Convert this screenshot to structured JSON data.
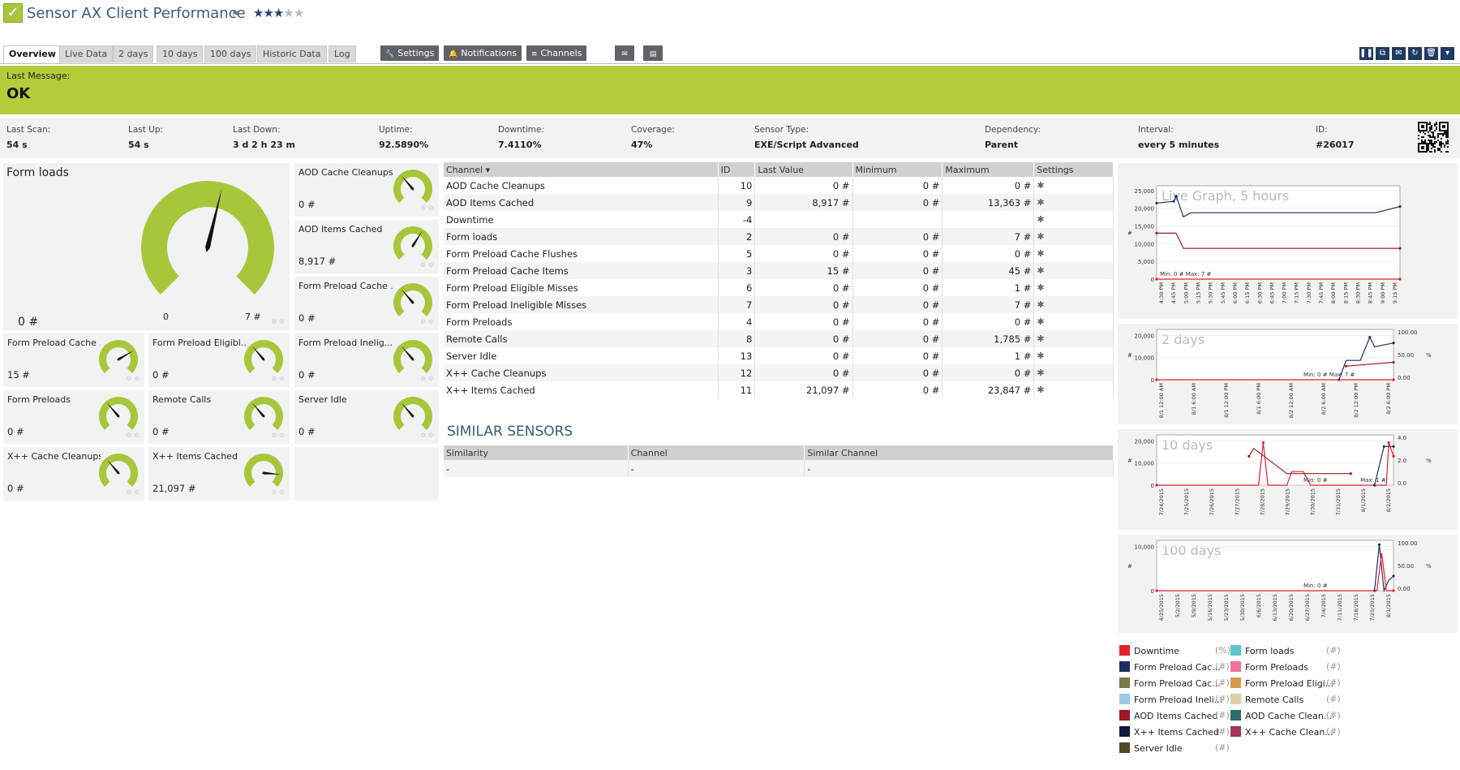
{
  "header": {
    "title": "Sensor AX Client Performance",
    "rating": 3,
    "rating_max": 5
  },
  "tabs": [
    "Overview",
    "Live Data",
    "2 days",
    "10 days",
    "100 days",
    "Historic Data",
    "Log"
  ],
  "actions": [
    "Settings",
    "Notifications",
    "Channels"
  ],
  "message": {
    "label": "Last Message:",
    "value": "OK"
  },
  "info": [
    {
      "label": "Last Scan:",
      "value": "54 s"
    },
    {
      "label": "Last Up:",
      "value": "54 s"
    },
    {
      "label": "Last Down:",
      "value": "3 d 2 h 23 m"
    },
    {
      "label": "Uptime:",
      "value": "92.5890%"
    },
    {
      "label": "Downtime:",
      "value": "7.4110%"
    },
    {
      "label": "Coverage:",
      "value": "47%"
    },
    {
      "label": "Sensor Type:",
      "value": "EXE/Script Advanced"
    },
    {
      "label": "Dependency:",
      "value": "Parent"
    },
    {
      "label": "Interval:",
      "value": "every 5 minutes"
    },
    {
      "label": "ID:",
      "value": "#26017"
    }
  ],
  "big_gauge": {
    "name": "Form loads",
    "value": "0 #",
    "min": "0",
    "max": "7 #",
    "fraction": 0.55
  },
  "gauges": [
    {
      "name": "AOD Cache Cleanups",
      "value": "0 #",
      "fraction": 0.35
    },
    {
      "name": "AOD Items Cached",
      "value": "8,917 #",
      "fraction": 0.62
    },
    {
      "name": "Form Preload Cache ...",
      "value": "0 #",
      "fraction": 0.35
    },
    {
      "name": "Form Preload Cache ...",
      "value": "15 #",
      "fraction": 0.72
    },
    {
      "name": "Form Preload Eligibl...",
      "value": "0 #",
      "fraction": 0.35
    },
    {
      "name": "Form Preload Inelig...",
      "value": "0 #",
      "fraction": 0.35
    },
    {
      "name": "Form Preloads",
      "value": "0 #",
      "fraction": 0.35
    },
    {
      "name": "Remote Calls",
      "value": "0 #",
      "fraction": 0.35
    },
    {
      "name": "Server Idle",
      "value": "0 #",
      "fraction": 0.35
    },
    {
      "name": "X++ Cache Cleanups",
      "value": "0 #",
      "fraction": 0.35
    },
    {
      "name": "X++ Items Cached",
      "value": "21,097 #",
      "fraction": 0.85
    }
  ],
  "channels_table": {
    "headers": [
      "Channel ▾",
      "ID",
      "Last Value",
      "Minimum",
      "Maximum",
      "Settings"
    ],
    "rows": [
      [
        "AOD Cache Cleanups",
        "10",
        "0 #",
        "0 #",
        "0 #"
      ],
      [
        "AOD Items Cached",
        "9",
        "8,917 #",
        "0 #",
        "13,363 #"
      ],
      [
        "Downtime",
        "-4",
        "",
        "",
        ""
      ],
      [
        "Form loads",
        "2",
        "0 #",
        "0 #",
        "7 #"
      ],
      [
        "Form Preload Cache Flushes",
        "5",
        "0 #",
        "0 #",
        "0 #"
      ],
      [
        "Form Preload Cache Items",
        "3",
        "15 #",
        "0 #",
        "45 #"
      ],
      [
        "Form Preload Eligible Misses",
        "6",
        "0 #",
        "0 #",
        "1 #"
      ],
      [
        "Form Preload Ineligible Misses",
        "7",
        "0 #",
        "0 #",
        "7 #"
      ],
      [
        "Form Preloads",
        "4",
        "0 #",
        "0 #",
        "0 #"
      ],
      [
        "Remote Calls",
        "8",
        "0 #",
        "0 #",
        "1,785 #"
      ],
      [
        "Server Idle",
        "13",
        "0 #",
        "0 #",
        "1 #"
      ],
      [
        "X++ Cache Cleanups",
        "12",
        "0 #",
        "0 #",
        "0 #"
      ],
      [
        "X++ Items Cached",
        "11",
        "21,097 #",
        "0 #",
        "23,847 #"
      ]
    ]
  },
  "similar": {
    "title": "SIMILAR SENSORS",
    "headers": [
      "Similarity",
      "Channel",
      "Similar Channel"
    ],
    "row": [
      "-",
      "-",
      "-"
    ]
  },
  "charts": [
    {
      "title": "Live Graph, 5 hours",
      "y_unit": "#",
      "y_ticks": [
        "25,000",
        "20,000",
        "15,000",
        "10,000",
        "5,000",
        "0"
      ],
      "x_ticks": [
        "4:30 PM",
        "4:45 PM",
        "5:00 PM",
        "5:15 PM",
        "5:30 PM",
        "5:45 PM",
        "6:00 PM",
        "6:15 PM",
        "6:30 PM",
        "6:45 PM",
        "7:00 PM",
        "7:15 PM",
        "7:30 PM",
        "7:45 PM",
        "8:00 PM",
        "8:15 PM",
        "8:30 PM",
        "8:45 PM",
        "9:00 PM",
        "9:15 PM"
      ],
      "minmax": "Min: 0 # Max: 7 #",
      "series": [
        {
          "color": "#1a2f5e",
          "points": [
            [
              0,
              22000
            ],
            [
              0.07,
              22500
            ],
            [
              0.08,
              24000
            ],
            [
              0.11,
              18000
            ],
            [
              0.14,
              19200
            ],
            [
              0.9,
              19200
            ],
            [
              1,
              21000
            ]
          ]
        },
        {
          "color": "#a31b25",
          "points": [
            [
              0,
              13300
            ],
            [
              0.08,
              13300
            ],
            [
              0.11,
              8900
            ],
            [
              1,
              8900
            ]
          ]
        },
        {
          "color": "#e81f2d",
          "points": [
            [
              0,
              0
            ],
            [
              1,
              0
            ]
          ]
        }
      ],
      "ymax": 27000
    },
    {
      "title": "2 days",
      "y_unit": "#",
      "y_ticks": [
        "20,000",
        "10,000",
        "0"
      ],
      "y2_ticks": [
        "100.00",
        "50.00",
        "0.00"
      ],
      "y2_unit": "%",
      "x_ticks": [
        "8/1 12:00 AM",
        "8/1 6:00 AM",
        "8/1 12:00 PM",
        "8/1 6:00 PM",
        "8/2 12:00 AM",
        "8/2 6:00 AM",
        "8/2 12:00 PM",
        "8/2 6:00 PM"
      ],
      "minmax": "Min: 0 #    Max: 7 #",
      "series": [
        {
          "color": "#1a2f5e",
          "points": [
            [
              0.77,
              0
            ],
            [
              0.8,
              10000
            ],
            [
              0.86,
              10000
            ],
            [
              0.9,
              22000
            ],
            [
              0.92,
              17000
            ],
            [
              1,
              19000
            ]
          ]
        },
        {
          "color": "#a31b25",
          "points": [
            [
              0.8,
              7000
            ],
            [
              1,
              9000
            ]
          ]
        },
        {
          "color": "#e81f2d",
          "points": [
            [
              0,
              0
            ],
            [
              1,
              0
            ]
          ]
        }
      ],
      "ymax": 26000
    },
    {
      "title": "10 days",
      "y_unit": "#",
      "y_ticks": [
        "20,000",
        "10,000",
        "0"
      ],
      "y2_ticks": [
        "4.0",
        "2.0",
        "0.0"
      ],
      "y2_unit": "%",
      "x_ticks": [
        "7/24/2015",
        "7/25/2015",
        "7/26/2015",
        "7/27/2015",
        "7/28/2015",
        "7/29/2015",
        "7/30/2015",
        "7/31/2015",
        "8/1/2015",
        "8/2/2015"
      ],
      "minmax": "Min: 0 #",
      "minmax2": "Max: 1 #",
      "series": [
        {
          "color": "#e81f2d",
          "points": [
            [
              0,
              0
            ],
            [
              0.43,
              0
            ],
            [
              0.45,
              22000
            ],
            [
              0.47,
              0
            ],
            [
              0.55,
              0
            ],
            [
              0.57,
              7000
            ],
            [
              0.62,
              7000
            ],
            [
              0.65,
              0
            ],
            [
              0.97,
              0
            ],
            [
              0.98,
              22000
            ],
            [
              1,
              15000
            ]
          ]
        },
        {
          "color": "#a31b25",
          "points": [
            [
              0.39,
              15000
            ],
            [
              0.41,
              19000
            ],
            [
              0.55,
              6000
            ],
            [
              0.6,
              6000
            ],
            [
              0.68,
              6000
            ],
            [
              0.82,
              6000
            ]
          ]
        },
        {
          "color": "#1a2f5e",
          "points": [
            [
              0.92,
              0
            ],
            [
              0.96,
              20000
            ],
            [
              1,
              20000
            ]
          ]
        }
      ],
      "ymax": 26000
    },
    {
      "title": "100 days",
      "y_unit": "#",
      "y_ticks": [
        "10,000",
        "0"
      ],
      "y2_ticks": [
        "100.00",
        "50.00",
        "0.00"
      ],
      "y2_unit": "%",
      "x_ticks": [
        "4/25/2015",
        "5/2/2015",
        "5/9/2015",
        "5/16/2015",
        "5/23/2015",
        "5/30/2015",
        "6/6/2015",
        "6/13/2015",
        "6/20/2015",
        "6/27/2015",
        "7/4/2015",
        "7/11/2015",
        "7/18/2015",
        "7/25/2015",
        "8/1/2015"
      ],
      "minmax": "Min: 0 #",
      "series": [
        {
          "color": "#1a2f5e",
          "points": [
            [
              0.92,
              0
            ],
            [
              0.94,
              22000
            ],
            [
              0.96,
              0
            ],
            [
              0.98,
              5000
            ],
            [
              1,
              7000
            ]
          ]
        },
        {
          "color": "#e81f2d",
          "points": [
            [
              0,
              0
            ],
            [
              0.93,
              0
            ],
            [
              0.95,
              18000
            ],
            [
              0.97,
              0
            ],
            [
              1,
              0
            ]
          ]
        }
      ],
      "ymax": 24000
    }
  ],
  "legend": [
    {
      "label": "Downtime",
      "unit": "(%)",
      "color": "#e81f2d"
    },
    {
      "label": "Form loads",
      "unit": "(#)",
      "color": "#5bc4c4"
    },
    {
      "label": "Form Preload Cac...",
      "unit": "(#)",
      "color": "#1a2f5e"
    },
    {
      "label": "Form Preloads",
      "unit": "(#)",
      "color": "#ef6f9e"
    },
    {
      "label": "Form Preload Cac...",
      "unit": "(#)",
      "color": "#7a7845"
    },
    {
      "label": "Form Preload Eligi...",
      "unit": "(#)",
      "color": "#d59a4c"
    },
    {
      "label": "Form Preload Ineli...",
      "unit": "(#)",
      "color": "#9ecae8"
    },
    {
      "label": "Remote Calls",
      "unit": "(#)",
      "color": "#dccfa8"
    },
    {
      "label": "AOD Items Cached",
      "unit": "(#)",
      "color": "#9c1825"
    },
    {
      "label": "AOD Cache Clean...",
      "unit": "(#)",
      "color": "#2f6b6b"
    },
    {
      "label": "X++ Items Cached",
      "unit": "(#)",
      "color": "#111a3c"
    },
    {
      "label": "X++ Cache Clean...",
      "unit": "(#)",
      "color": "#a3345c"
    },
    {
      "label": "Server Idle",
      "unit": "(#)",
      "color": "#4d4a2a"
    }
  ],
  "colors": {
    "accent": "#b3cd3a",
    "gauge": "#a8c63a",
    "header_text": "#3c5a78"
  }
}
